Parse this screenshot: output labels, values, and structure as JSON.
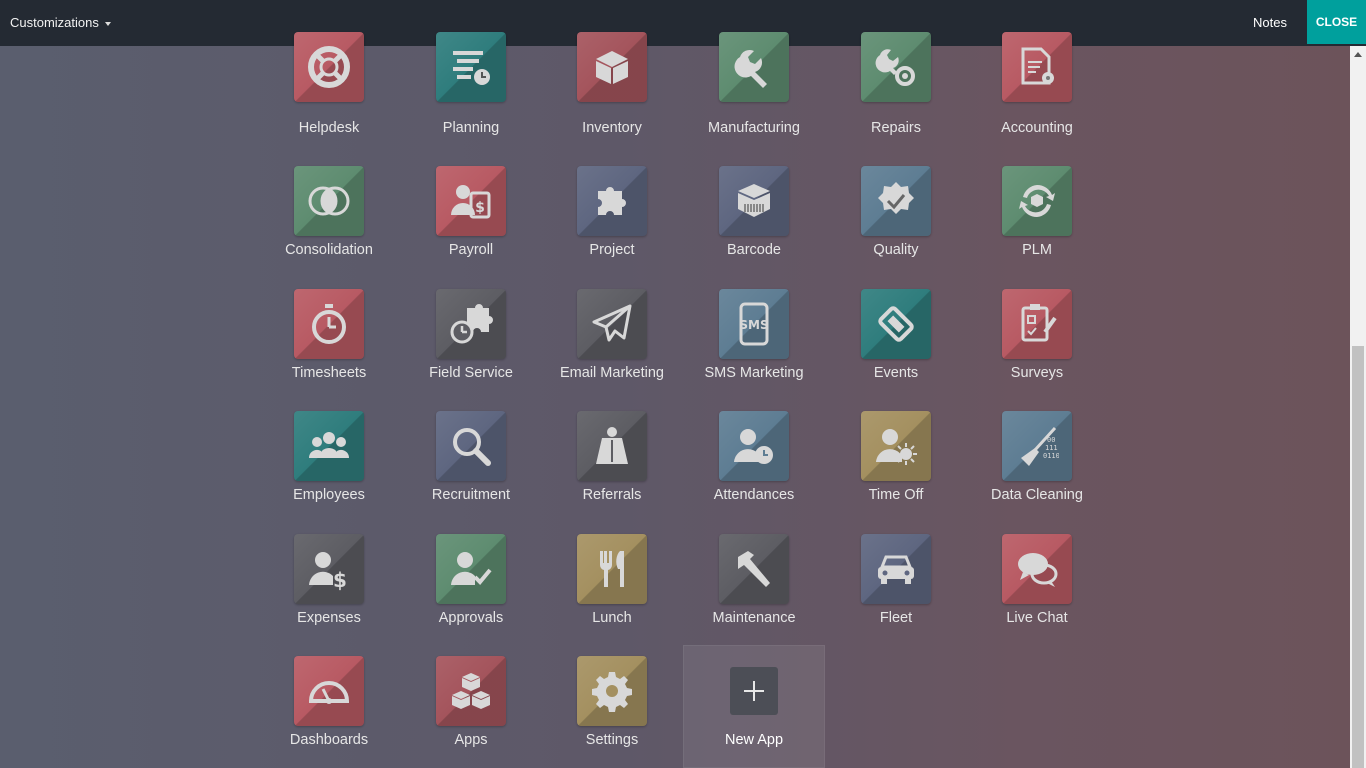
{
  "topbar": {
    "menu_label": "Customizations",
    "notes_label": "Notes",
    "close_label": "CLOSE"
  },
  "apps": [
    {
      "label": "Helpdesk",
      "icon": "lifebuoy-icon",
      "color": "#b85a63"
    },
    {
      "label": "Planning",
      "icon": "planning-icon",
      "color": "#2f7d7d"
    },
    {
      "label": "Inventory",
      "icon": "box-icon",
      "color": "#a4545c"
    },
    {
      "label": "Manufacturing",
      "icon": "wrench-icon",
      "color": "#5e8c70"
    },
    {
      "label": "Repairs",
      "icon": "repair-tools-icon",
      "color": "#5e8c70"
    },
    {
      "label": "Accounting",
      "icon": "document-gear-icon",
      "color": "#b85a63"
    },
    {
      "label": "Consolidation",
      "icon": "venn-circles-icon",
      "color": "#5e8c70"
    },
    {
      "label": "Payroll",
      "icon": "payroll-icon",
      "color": "#b85a63"
    },
    {
      "label": "Project",
      "icon": "puzzle-icon",
      "color": "#5e6680"
    },
    {
      "label": "Barcode",
      "icon": "barcode-box-icon",
      "color": "#5e6680"
    },
    {
      "label": "Quality",
      "icon": "quality-badge-icon",
      "color": "#5e7d93"
    },
    {
      "label": "PLM",
      "icon": "cycle-cube-icon",
      "color": "#5e8c70"
    },
    {
      "label": "Timesheets",
      "icon": "stopwatch-icon",
      "color": "#b85a63"
    },
    {
      "label": "Field Service",
      "icon": "field-service-icon",
      "color": "#5d5d63"
    },
    {
      "label": "Email Marketing",
      "icon": "paper-plane-icon",
      "color": "#5d5d63"
    },
    {
      "label": "SMS Marketing",
      "icon": "sms-phone-icon",
      "color": "#5e7d93"
    },
    {
      "label": "Events",
      "icon": "ticket-icon",
      "color": "#2f7d7d"
    },
    {
      "label": "Surveys",
      "icon": "survey-clipboard-icon",
      "color": "#b85a63"
    },
    {
      "label": "Employees",
      "icon": "people-group-icon",
      "color": "#2f7d7d"
    },
    {
      "label": "Recruitment",
      "icon": "magnifier-icon",
      "color": "#5e6680"
    },
    {
      "label": "Referrals",
      "icon": "hero-cape-icon",
      "color": "#5d5d63"
    },
    {
      "label": "Attendances",
      "icon": "user-clock-icon",
      "color": "#5e7d93"
    },
    {
      "label": "Time Off",
      "icon": "user-sun-icon",
      "color": "#a49060"
    },
    {
      "label": "Data Cleaning",
      "icon": "broom-binary-icon",
      "color": "#5e7d93"
    },
    {
      "label": "Expenses",
      "icon": "user-dollar-icon",
      "color": "#5d5d63"
    },
    {
      "label": "Approvals",
      "icon": "user-check-icon",
      "color": "#5e8c70"
    },
    {
      "label": "Lunch",
      "icon": "fork-knife-icon",
      "color": "#a49060"
    },
    {
      "label": "Maintenance",
      "icon": "hammer-icon",
      "color": "#5d5d63"
    },
    {
      "label": "Fleet",
      "icon": "car-icon",
      "color": "#5e6680"
    },
    {
      "label": "Live Chat",
      "icon": "chat-bubbles-icon",
      "color": "#b85a63"
    },
    {
      "label": "Dashboards",
      "icon": "gauge-icon",
      "color": "#b85a63"
    },
    {
      "label": "Apps",
      "icon": "cubes-icon",
      "color": "#a4545c"
    },
    {
      "label": "Settings",
      "icon": "gear-icon",
      "color": "#a49060"
    }
  ],
  "new_app": {
    "label": "New App",
    "icon": "plus-icon"
  },
  "colors": {
    "topbar": "#242a33",
    "accent": "#00a09d"
  }
}
